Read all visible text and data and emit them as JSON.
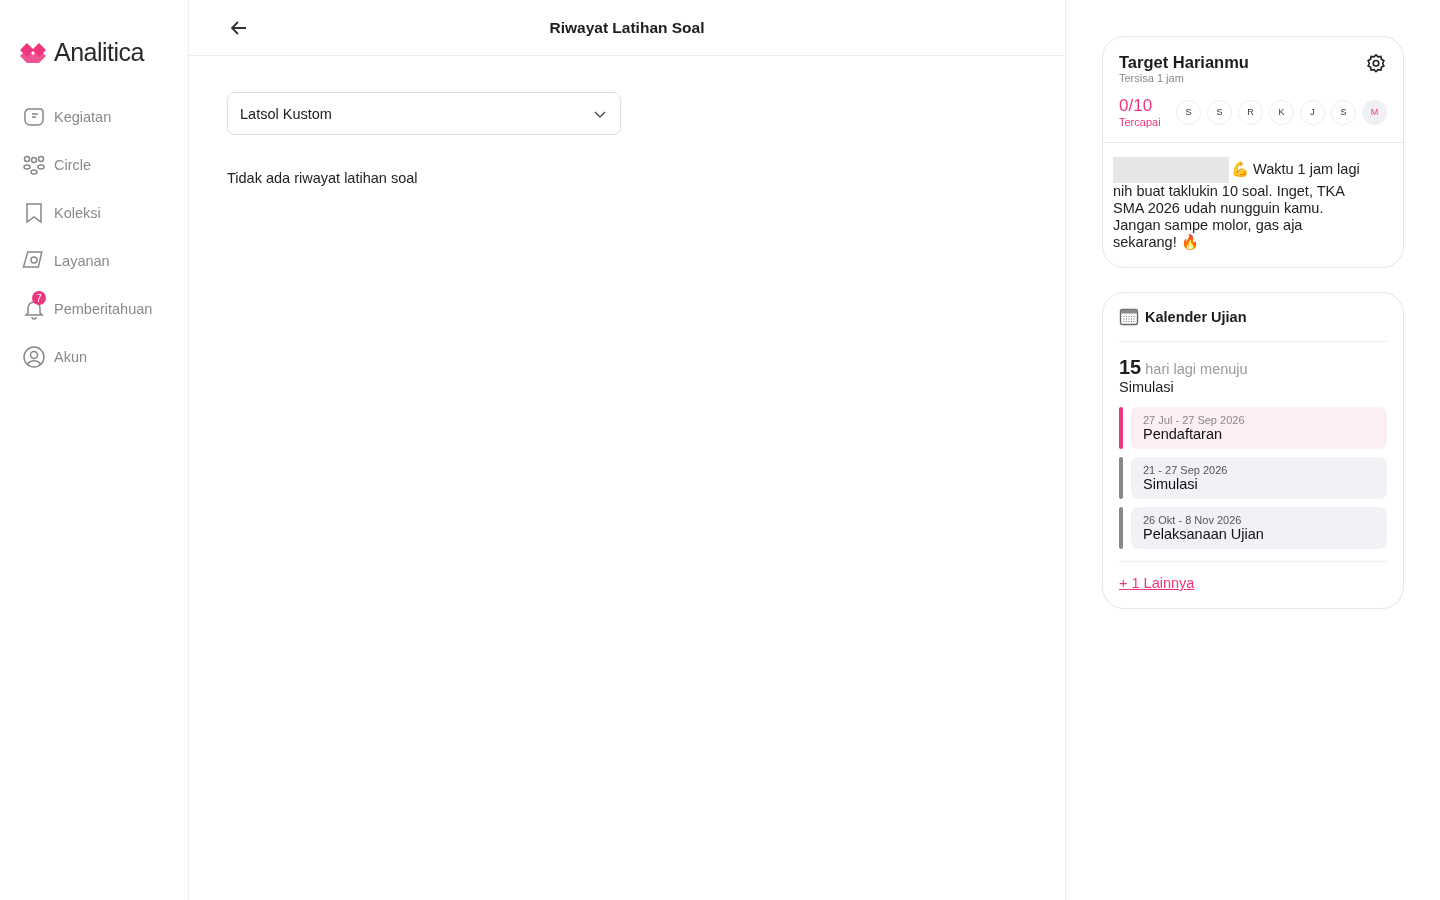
{
  "brand": {
    "name": "Analitica"
  },
  "sidebar": {
    "items": [
      {
        "label": "Kegiatan"
      },
      {
        "label": "Circle"
      },
      {
        "label": "Koleksi"
      },
      {
        "label": "Layanan"
      },
      {
        "label": "Pemberitahuan",
        "badge": "7"
      },
      {
        "label": "Akun"
      }
    ]
  },
  "header": {
    "title": "Riwayat Latihan Soal"
  },
  "filter": {
    "value": "Latsol Kustom"
  },
  "empty_message": "Tidak ada riwayat latihan soal",
  "target": {
    "title": "Target Harianmu",
    "subtitle": "Tersisa 1 jam",
    "progress": "0/10",
    "progress_label": "Tercapai",
    "days": [
      {
        "label": "S",
        "today": false
      },
      {
        "label": "S",
        "today": false
      },
      {
        "label": "R",
        "today": false
      },
      {
        "label": "K",
        "today": false
      },
      {
        "label": "J",
        "today": false
      },
      {
        "label": "S",
        "today": false
      },
      {
        "label": "M",
        "today": true
      }
    ],
    "message": "💪 Waktu 1 jam lagi nih buat taklukin 10 soal. Inget, TKA SMA 2026 udah nungguin kamu. Jangan sampe molor, gas aja sekarang! 🔥"
  },
  "calendar": {
    "title": "Kalender Ujian",
    "count": "15",
    "count_text": "hari lagi menuju",
    "next_event": "Simulasi",
    "events": [
      {
        "dates": "27 Jul - 27 Sep 2026",
        "name": "Pendaftaran",
        "active": true
      },
      {
        "dates": "21 - 27 Sep 2026",
        "name": "Simulasi",
        "active": false
      },
      {
        "dates": "26 Okt - 8 Nov 2026",
        "name": "Pelaksanaan Ujian",
        "active": false
      }
    ],
    "more_link": "+ 1 Lainnya"
  }
}
